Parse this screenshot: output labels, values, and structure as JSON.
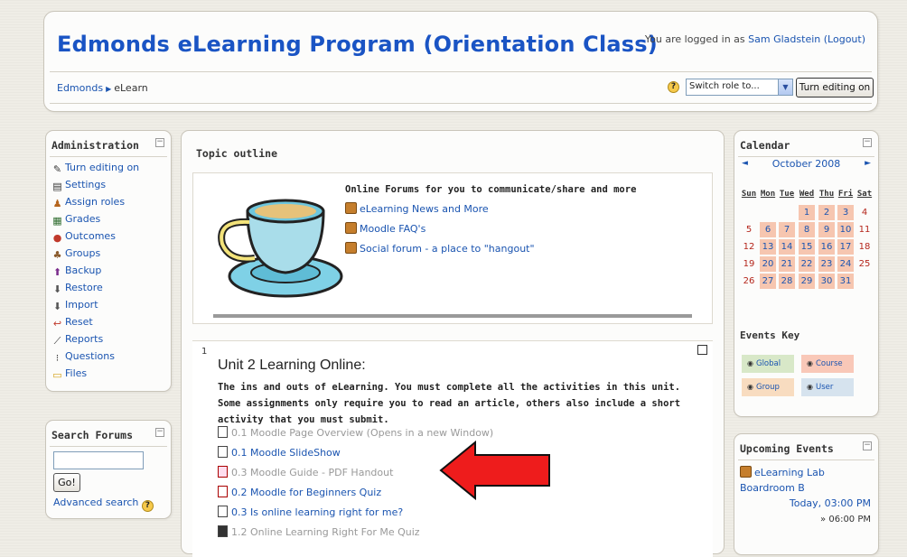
{
  "header": {
    "site_title": "Edmonds eLearning Program (Orientation Class)",
    "login_prefix": "You are logged in as",
    "user_name": "Sam Gladstein",
    "logout_label": "(Logout)",
    "breadcrumb": [
      "Edmonds",
      "eLearn"
    ],
    "switch_role_label": "Switch role to...",
    "turn_editing_label": "Turn editing on"
  },
  "admin_block": {
    "title": "Administration",
    "items": [
      {
        "label": "Turn editing on",
        "icon": "pencil-icon"
      },
      {
        "label": "Settings",
        "icon": "settings-icon"
      },
      {
        "label": "Assign roles",
        "icon": "roles-icon"
      },
      {
        "label": "Grades",
        "icon": "grades-icon"
      },
      {
        "label": "Outcomes",
        "icon": "outcomes-icon"
      },
      {
        "label": "Groups",
        "icon": "groups-icon"
      },
      {
        "label": "Backup",
        "icon": "backup-icon"
      },
      {
        "label": "Restore",
        "icon": "restore-icon"
      },
      {
        "label": "Import",
        "icon": "import-icon"
      },
      {
        "label": "Reset",
        "icon": "reset-icon"
      },
      {
        "label": "Reports",
        "icon": "reports-icon"
      },
      {
        "label": "Questions",
        "icon": "questions-icon"
      },
      {
        "label": "Files",
        "icon": "folder-icon"
      }
    ]
  },
  "search_block": {
    "title": "Search Forums",
    "go_label": "Go!",
    "advanced_label": "Advanced search"
  },
  "main": {
    "topic_title": "Topic outline",
    "forum_heading": "Online Forums for you to communicate/share and more",
    "forums": [
      "eLearning News and More",
      "Moodle FAQ's",
      "Social forum - a place to \"hangout\""
    ],
    "section_number": "1",
    "unit_title": "Unit 2 Learning Online:",
    "unit_description": "The ins and outs of eLearning. You must complete all the activities in this unit. Some assignments only require you to read an article, others also include a short activity that you must submit.",
    "activities": [
      {
        "label": "0.1 Moodle Page Overview (Opens in a new Window)",
        "hidden": true,
        "icon": "page-icon"
      },
      {
        "label": "0.1 Moodle SlideShow",
        "hidden": false,
        "icon": "page-icon"
      },
      {
        "label": "0.3 Moodle Guide - PDF Handout",
        "hidden": true,
        "icon": "pdf-icon"
      },
      {
        "label": "0.2 Moodle for Beginners Quiz",
        "hidden": false,
        "icon": "quiz-icon"
      },
      {
        "label": "0.3 Is online learning right for me?",
        "hidden": false,
        "icon": "page-icon"
      },
      {
        "label": "1.2 Online Learning Right For Me Quiz",
        "hidden": true,
        "icon": "quiz-icon"
      }
    ]
  },
  "calendar": {
    "title": "Calendar",
    "month": "October 2008",
    "prev": "◄",
    "next": "►",
    "day_headers": [
      "Sun",
      "Mon",
      "Tue",
      "Wed",
      "Thu",
      "Fri",
      "Sat"
    ],
    "weeks": [
      [
        "",
        "",
        "",
        "1",
        "2",
        "3",
        "4"
      ],
      [
        "5",
        "6",
        "7",
        "8",
        "9",
        "10",
        "11"
      ],
      [
        "12",
        "13",
        "14",
        "15",
        "16",
        "17",
        "18"
      ],
      [
        "19",
        "20",
        "21",
        "22",
        "23",
        "24",
        "25"
      ],
      [
        "26",
        "27",
        "28",
        "29",
        "30",
        "31",
        ""
      ]
    ],
    "events_key_title": "Events Key",
    "events_key": [
      "Global",
      "Course",
      "Group",
      "User"
    ],
    "colors": {
      "course_day": "#f6c6b0",
      "global": "#d8e8c8",
      "course": "#f9c8b8",
      "group": "#f8dcc0",
      "user": "#d6e3ee"
    }
  },
  "upcoming": {
    "title": "Upcoming Events",
    "event_title": "eLearning Lab Boardroom B",
    "event_time": "Today, 03:00 PM",
    "event_end": "» 06:00 PM"
  }
}
